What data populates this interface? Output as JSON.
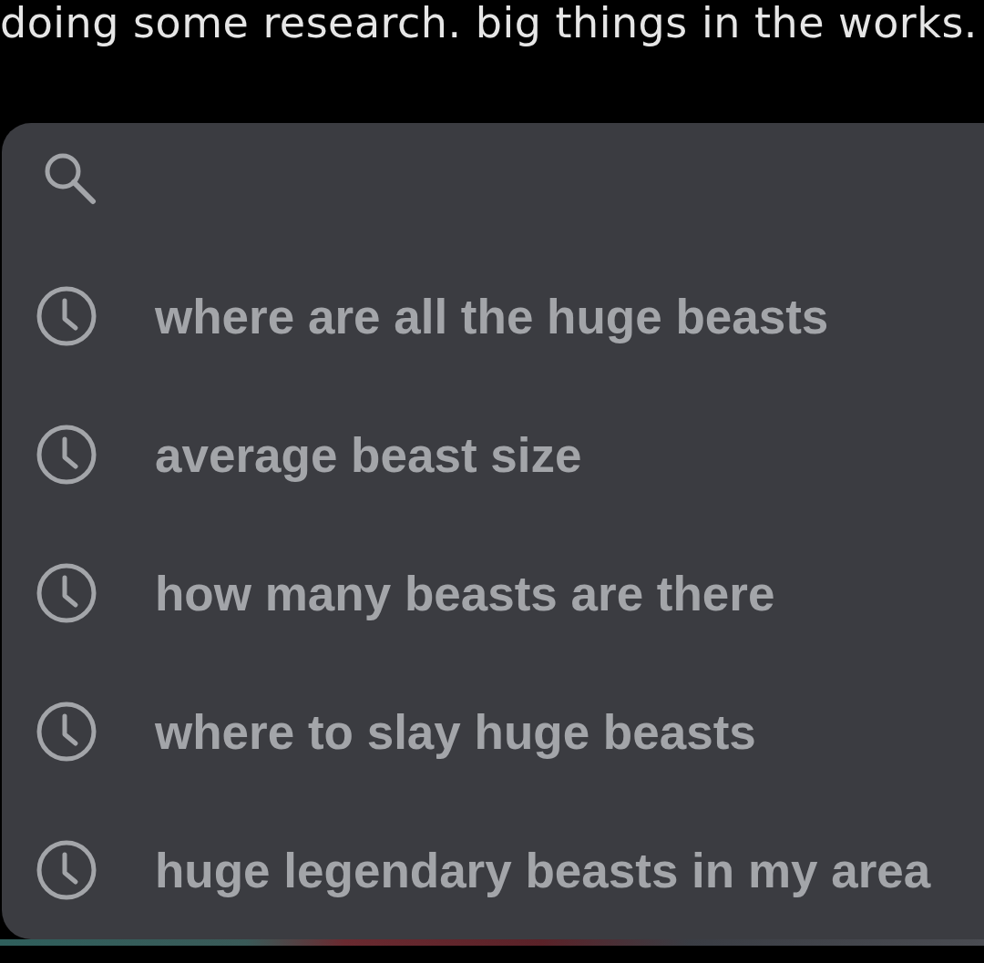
{
  "caption": "doing some research. big things in the works.",
  "recent_searches": [
    {
      "text": "where are all the huge beasts"
    },
    {
      "text": "average beast size"
    },
    {
      "text": "how many beasts are there"
    },
    {
      "text": "where to slay huge beasts"
    },
    {
      "text": "huge legendary beasts in my area"
    }
  ]
}
